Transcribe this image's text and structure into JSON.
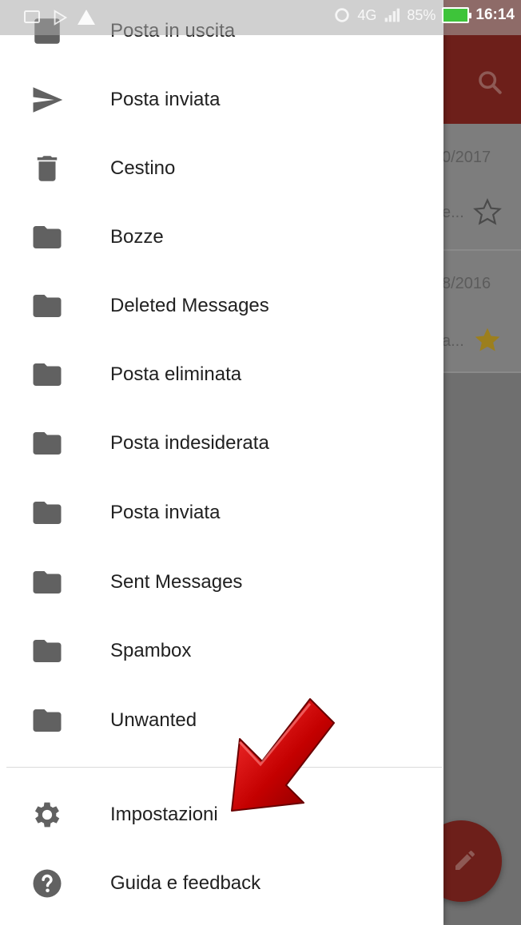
{
  "status_bar": {
    "network": "4G",
    "battery": "85%",
    "time": "16:14"
  },
  "drawer": {
    "items": [
      {
        "label": "Posta in uscita",
        "icon": "outbox-icon"
      },
      {
        "label": "Posta inviata",
        "icon": "send-icon"
      },
      {
        "label": "Cestino",
        "icon": "trash-icon"
      },
      {
        "label": "Bozze",
        "icon": "folder-icon"
      },
      {
        "label": "Deleted Messages",
        "icon": "folder-icon"
      },
      {
        "label": "Posta eliminata",
        "icon": "folder-icon"
      },
      {
        "label": "Posta indesiderata",
        "icon": "folder-icon"
      },
      {
        "label": "Posta inviata",
        "icon": "folder-icon"
      },
      {
        "label": "Sent Messages",
        "icon": "folder-icon"
      },
      {
        "label": "Spambox",
        "icon": "folder-icon"
      },
      {
        "label": "Unwanted",
        "icon": "folder-icon"
      }
    ],
    "footer_items": [
      {
        "label": "Impostazioni",
        "icon": "gear-icon"
      },
      {
        "label": "Guida e feedback",
        "icon": "help-icon"
      }
    ]
  },
  "background_list": {
    "rows": [
      {
        "date": "0/2017",
        "snippet": "e...",
        "starred": false
      },
      {
        "date": "8/2016",
        "snippet": "a...",
        "starred": true
      }
    ]
  },
  "colors": {
    "toolbar": "#6d1f1a",
    "icon_grey": "#616161",
    "star_gold": "#c9a227",
    "arrow_red": "#d00000"
  }
}
